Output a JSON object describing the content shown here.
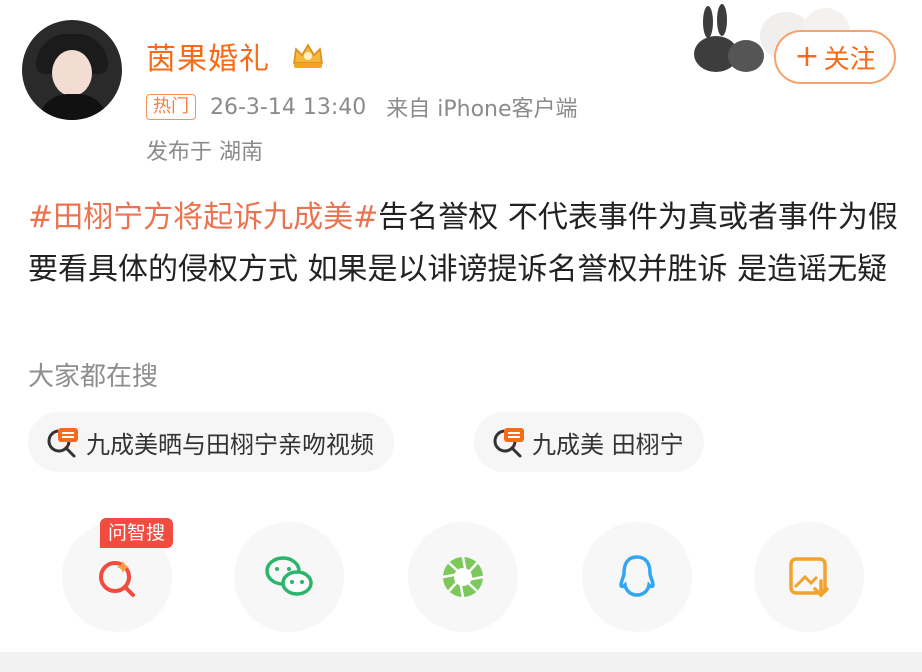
{
  "header": {
    "avatar_icon": "user-avatar",
    "username": "茵果婚礼",
    "vip_icon": "crown-badge-icon",
    "follow_label": "关注",
    "follow_icon": "plus-icon",
    "hot_badge": "热门",
    "time": "26-3-14 13:40",
    "source": "来自 iPhone客户端",
    "location": "发布于 湖南"
  },
  "post": {
    "tag": "#田栩宁方将起诉九成美#",
    "text": "告名誉权 不代表事件为真或者事件为假 要看具体的侵权方式 如果是以诽谤提诉名誉权并胜诉 是造谣无疑"
  },
  "search": {
    "title": "大家都在搜",
    "items": [
      {
        "icon": "hot-search-icon",
        "label": "九成美晒与田栩宁亲吻视频"
      },
      {
        "icon": "hot-search-icon",
        "label": "九成美 田栩宁"
      }
    ]
  },
  "share": {
    "ai_tag": "问智搜",
    "buttons": [
      {
        "icon": "ai-search-icon"
      },
      {
        "icon": "wechat-icon"
      },
      {
        "icon": "moments-icon"
      },
      {
        "icon": "qq-icon"
      },
      {
        "icon": "save-image-icon"
      }
    ]
  },
  "colors": {
    "accent_orange": "#f76b18",
    "hashtag": "#eb7350",
    "meta_gray": "#8b8b8b",
    "ai_tag_red": "#f24b3f"
  }
}
